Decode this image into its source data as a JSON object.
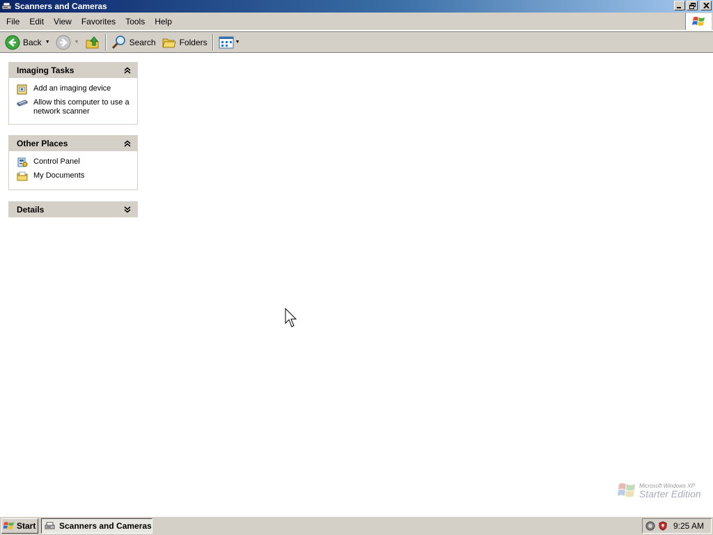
{
  "window": {
    "title": "Scanners and Cameras",
    "icon": "scanner-camera-icon"
  },
  "menubar": {
    "items": [
      "File",
      "Edit",
      "View",
      "Favorites",
      "Tools",
      "Help"
    ],
    "logo": "windows-flag-icon"
  },
  "toolbar": {
    "back_label": "Back",
    "search_label": "Search",
    "folders_label": "Folders"
  },
  "panels": {
    "imaging_tasks": {
      "title": "Imaging Tasks",
      "items": [
        {
          "label": "Add an imaging device",
          "icon": "add-device-icon"
        },
        {
          "label": "Allow this computer to use a network scanner",
          "icon": "network-scanner-icon"
        }
      ]
    },
    "other_places": {
      "title": "Other Places",
      "items": [
        {
          "label": "Control Panel",
          "icon": "control-panel-icon"
        },
        {
          "label": "My Documents",
          "icon": "my-documents-icon"
        }
      ]
    },
    "details": {
      "title": "Details"
    }
  },
  "watermark": {
    "small_text": "Microsoft Windows XP",
    "big_text": "Starter Edition"
  },
  "taskbar": {
    "start_label": "Start",
    "task_label": "Scanners and Cameras",
    "clock": "9:25 AM"
  },
  "colors": {
    "titlebar_start": "#0a246a",
    "titlebar_end": "#a6caf0",
    "chrome": "#d4d0c8"
  }
}
